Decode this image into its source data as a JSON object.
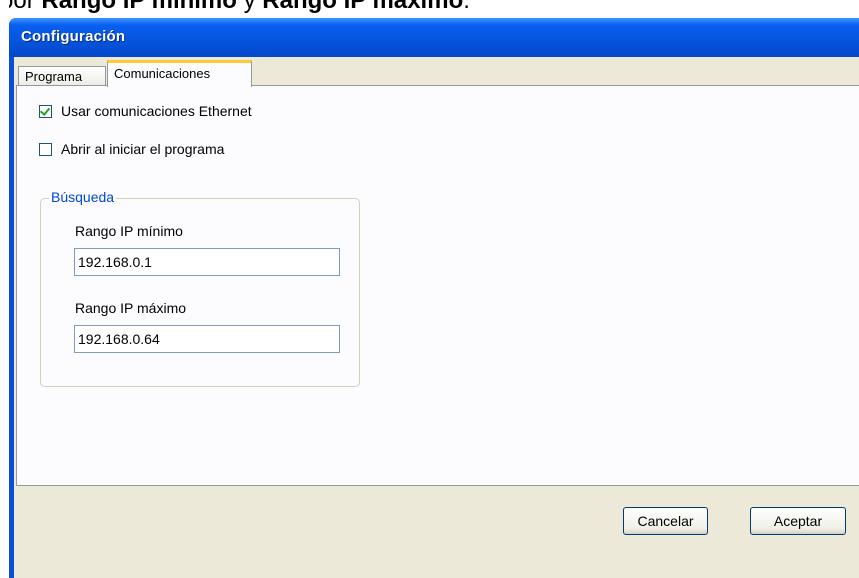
{
  "document": {
    "prefix": "por ",
    "bold1": "Rango IP mínimo",
    "middle": " y ",
    "bold2": "Rango IP máximo",
    "suffix": "."
  },
  "window": {
    "title": "Configuración"
  },
  "tabs": [
    {
      "label": "Programa",
      "active": false
    },
    {
      "label": "Comunicaciones",
      "active": true
    }
  ],
  "options": {
    "ethernet": {
      "label": "Usar comunicaciones Ethernet",
      "checked": true
    },
    "open_on_start": {
      "label": "Abrir al iniciar el programa",
      "checked": false
    }
  },
  "search_group": {
    "legend": "Búsqueda",
    "min_ip": {
      "label": "Rango IP mínimo",
      "value": "192.168.0.1"
    },
    "max_ip": {
      "label": "Rango IP máximo",
      "value": "192.168.0.64"
    }
  },
  "buttons": {
    "cancel": "Cancelar",
    "ok": "Aceptar"
  },
  "colors": {
    "titlebar": "#0556e0",
    "accent_tab": "#ffc83c",
    "legend": "#0046d5",
    "checkmark": "#21a121"
  }
}
